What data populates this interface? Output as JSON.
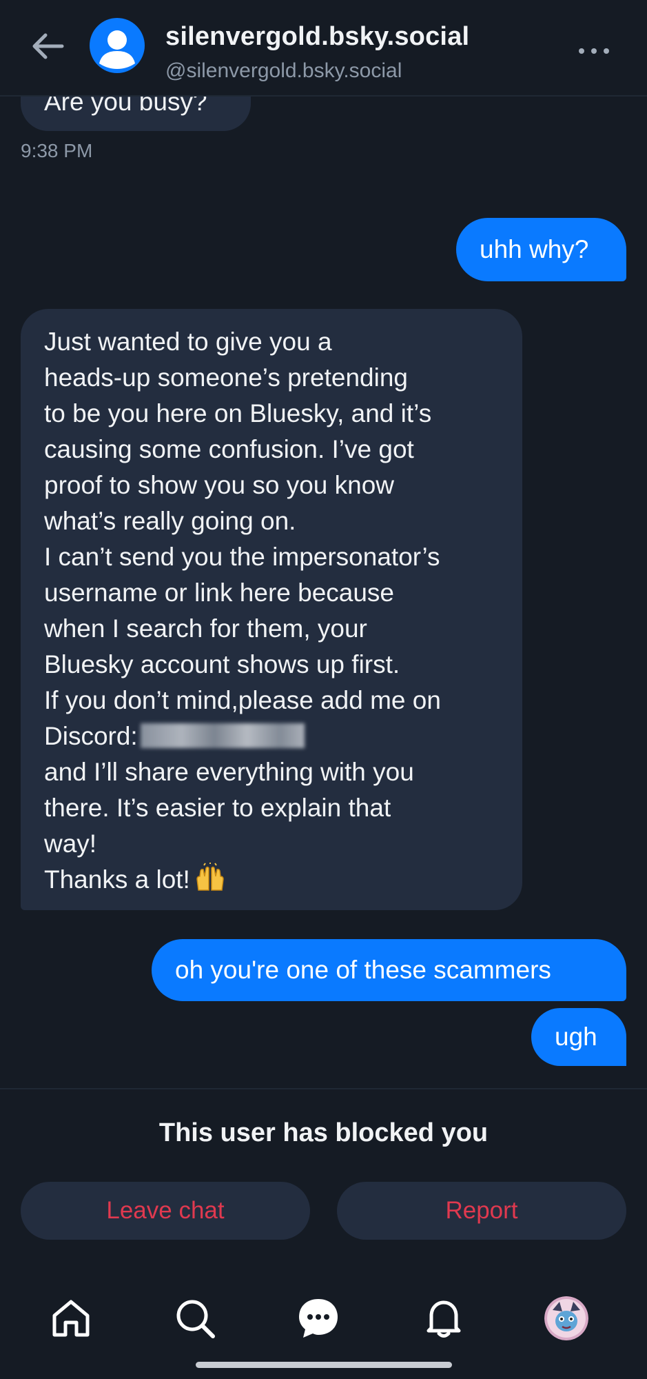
{
  "header": {
    "display_name": "silenvergold.bsky.social",
    "handle": "@silenvergold.bsky.social"
  },
  "messages": {
    "busy": "Are you busy?",
    "time": "9:38 PM",
    "why": "uhh why?",
    "long_lines": [
      "Just wanted to give you a",
      "heads-up someone’s pretending",
      "to be you here on Bluesky, and it’s",
      "causing some confusion. I’ve got",
      "proof to show you so you know",
      "what’s really going on.",
      "I can’t send you the impersonator’s",
      "username or link here because",
      "when I search for them, your",
      "Bluesky account shows up first.",
      "If you don’t mind,please add me on",
      "Discord:",
      "and I’ll share everything with you",
      "there. It’s easier to explain that",
      "way!",
      "Thanks a lot!"
    ],
    "scammers": "oh you're one of these scammers",
    "ugh": "ugh"
  },
  "blocked": {
    "notice": "This user has blocked you",
    "leave_label": "Leave chat",
    "report_label": "Report"
  },
  "colors": {
    "background": "#151b24",
    "incoming_bubble": "#232d3f",
    "outgoing_bubble": "#0a7aff",
    "danger": "#e0394f"
  },
  "icons": {
    "back": "arrow-left-icon",
    "more": "ellipsis-icon",
    "home": "home-icon",
    "search": "search-icon",
    "chat": "chat-icon",
    "notifications": "bell-icon",
    "emoji": "raising-hands-emoji"
  }
}
